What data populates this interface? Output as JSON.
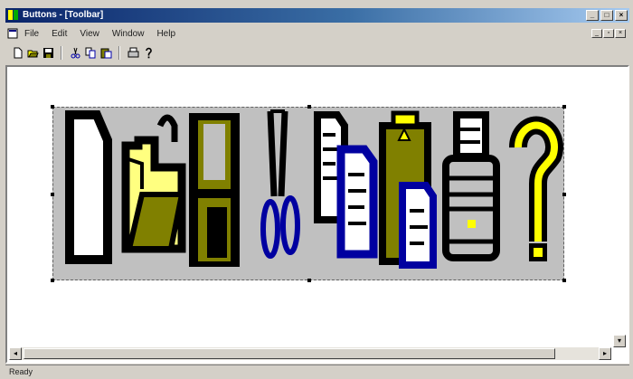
{
  "window": {
    "title": "Buttons - [Toolbar]"
  },
  "menu": {
    "items": [
      "File",
      "Edit",
      "View",
      "Window",
      "Help"
    ]
  },
  "toolbar": {
    "icons": [
      "new-icon",
      "open-icon",
      "save-icon",
      "cut-icon",
      "copy-icon",
      "paste-icon",
      "print-icon",
      "help-icon"
    ]
  },
  "status": {
    "text": "Ready"
  },
  "colors": {
    "olive": "#808000",
    "yellow": "#ffff00",
    "blue": "#0000a0",
    "gray": "#c0c0c0"
  }
}
